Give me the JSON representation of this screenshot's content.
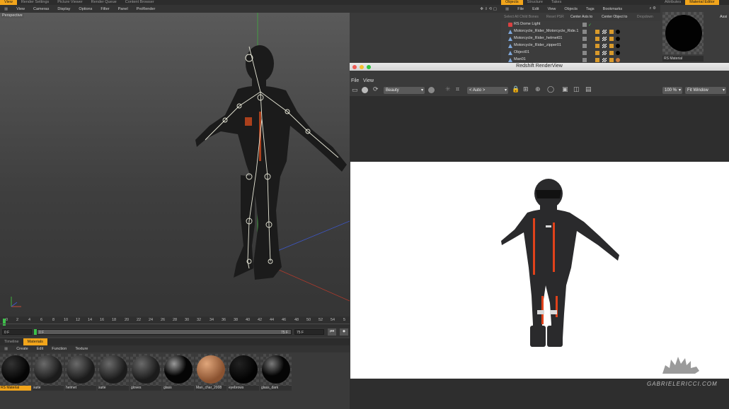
{
  "top_tabs": [
    "View",
    "Render Settings",
    "Picture Viewer",
    "Render Queue",
    "Content Browser"
  ],
  "viewport_menu": [
    "View",
    "Cameras",
    "Display",
    "Options",
    "Filter",
    "Panel",
    "ProRender"
  ],
  "viewport_label": "Perspective",
  "timeline": {
    "ticks": [
      "0",
      "2",
      "4",
      "6",
      "8",
      "10",
      "12",
      "14",
      "16",
      "18",
      "20",
      "22",
      "24",
      "26",
      "28",
      "30",
      "32",
      "34",
      "36",
      "38",
      "40",
      "42",
      "44",
      "46",
      "48",
      "50",
      "52",
      "54",
      "5"
    ],
    "current_frame": "0 F",
    "start_field": "0 F",
    "end_field": "75 F",
    "end_field2": "75 F"
  },
  "material_tabs": [
    "Timeline",
    "Materials"
  ],
  "material_menu": [
    "Create",
    "Edit",
    "Function",
    "Texture"
  ],
  "materials": [
    {
      "name": "RS Material",
      "color": "#050505"
    },
    {
      "name": "suite",
      "color": "#2b2b2b"
    },
    {
      "name": "helmet",
      "color": "#2b2b2b"
    },
    {
      "name": "suite",
      "color": "#2b2b2b"
    },
    {
      "name": "gloves",
      "color": "#2b2b2b"
    },
    {
      "name": "glass",
      "color": "#0a0a0a"
    },
    {
      "name": "Man_char_2008",
      "color": "#c9875a"
    },
    {
      "name": "eyebrows",
      "color": "#050505"
    },
    {
      "name": "glass_dark",
      "color": "#080808"
    }
  ],
  "objects_tabs": [
    "Objects",
    "Structure",
    "Takes"
  ],
  "objects_menu": [
    "File",
    "Edit",
    "View",
    "Objects",
    "Tags",
    "Bookmarks"
  ],
  "objects_buttons": [
    "Select All Child Bones",
    "Reset PSR",
    "Center Axis to",
    "Center Object to",
    "Dropdown"
  ],
  "objects": [
    {
      "name": "RS Dome Light"
    },
    {
      "name": "Motorcycle_Rider_Motorcycle_Ride.1"
    },
    {
      "name": "Motorcycle_Rider_helmet01"
    },
    {
      "name": "Motorcycle_Rider_zipper01"
    },
    {
      "name": "Object01"
    },
    {
      "name": "Man01"
    }
  ],
  "attr_tabs": [
    "Attributes",
    "Material Editor"
  ],
  "attr_material_label": "RS Material",
  "attr_side_label": "Assi",
  "render_view": {
    "title": "Redshift RenderView",
    "menu": [
      "File",
      "View"
    ],
    "aov_select": "Beauty",
    "camera_select": "< Auto >",
    "zoom": "100 %",
    "fit_select": "Fit Window"
  },
  "watermark": "GABRIELERICCI.COM",
  "colors": {
    "accent": "#f2a51b",
    "render_bg": "#ffffff",
    "suit_red": "#e0421b"
  }
}
